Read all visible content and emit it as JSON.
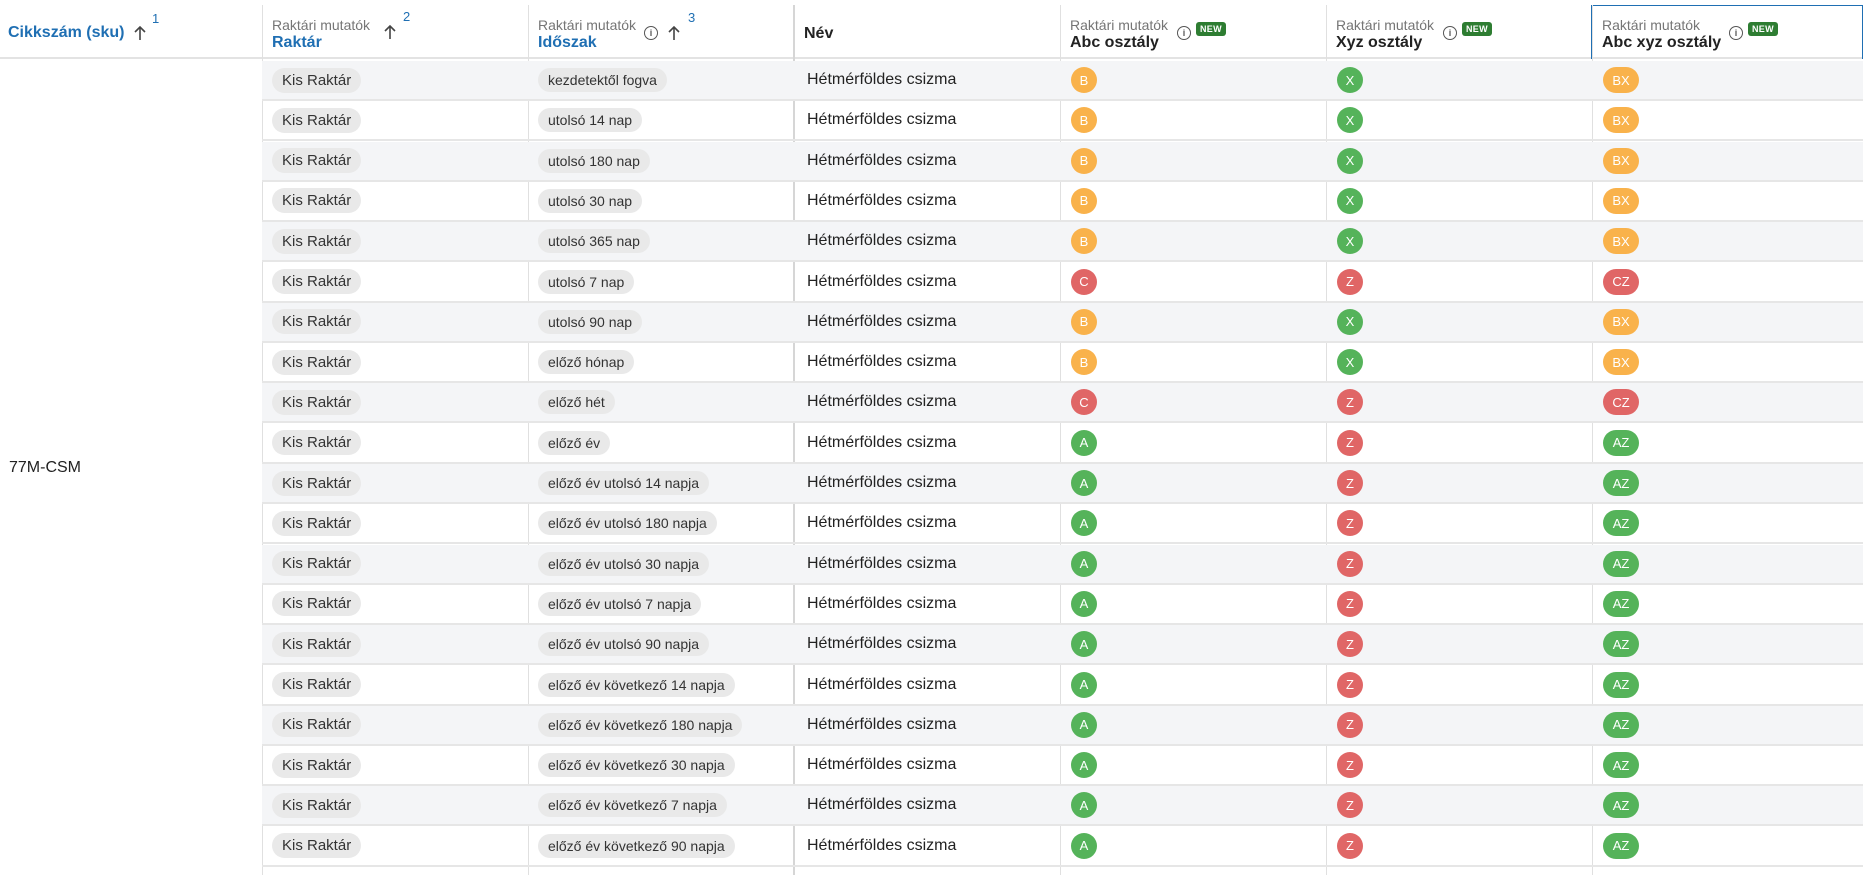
{
  "header": {
    "sku": {
      "title": "Cikkszám (sku)",
      "sort_index": "1"
    },
    "warehouse": {
      "group": "Raktári mutatók",
      "title": "Raktár",
      "sort_index": "2"
    },
    "period": {
      "group": "Raktári mutatók",
      "title": "Időszak",
      "sort_index": "3"
    },
    "name": {
      "title": "Név"
    },
    "abc": {
      "group": "Raktári mutatók",
      "title": "Abc osztály",
      "badge": "NEW"
    },
    "xyz": {
      "group": "Raktári mutatók",
      "title": "Xyz osztály",
      "badge": "NEW"
    },
    "abcxyz": {
      "group": "Raktári mutatók",
      "title": "Abc xyz osztály",
      "badge": "NEW"
    }
  },
  "sku_value": "77M-CSM",
  "colors": {
    "A": "#55b35a",
    "B": "#f9b24b",
    "C": "#e06666",
    "X": "#55b35a",
    "Z": "#e06666",
    "accent": "#1f6fb3"
  },
  "rows": [
    {
      "warehouse": "Kis Raktár",
      "period": "kezdetektől fogva",
      "name": "Hétmérföldes csizma",
      "abc": "B",
      "xyz": "X",
      "abcxyz": "BX"
    },
    {
      "warehouse": "Kis Raktár",
      "period": "utolsó 14 nap",
      "name": "Hétmérföldes csizma",
      "abc": "B",
      "xyz": "X",
      "abcxyz": "BX"
    },
    {
      "warehouse": "Kis Raktár",
      "period": "utolsó 180 nap",
      "name": "Hétmérföldes csizma",
      "abc": "B",
      "xyz": "X",
      "abcxyz": "BX"
    },
    {
      "warehouse": "Kis Raktár",
      "period": "utolsó 30 nap",
      "name": "Hétmérföldes csizma",
      "abc": "B",
      "xyz": "X",
      "abcxyz": "BX"
    },
    {
      "warehouse": "Kis Raktár",
      "period": "utolsó 365 nap",
      "name": "Hétmérföldes csizma",
      "abc": "B",
      "xyz": "X",
      "abcxyz": "BX"
    },
    {
      "warehouse": "Kis Raktár",
      "period": "utolsó 7 nap",
      "name": "Hétmérföldes csizma",
      "abc": "C",
      "xyz": "Z",
      "abcxyz": "CZ"
    },
    {
      "warehouse": "Kis Raktár",
      "period": "utolsó 90 nap",
      "name": "Hétmérföldes csizma",
      "abc": "B",
      "xyz": "X",
      "abcxyz": "BX"
    },
    {
      "warehouse": "Kis Raktár",
      "period": "előző hónap",
      "name": "Hétmérföldes csizma",
      "abc": "B",
      "xyz": "X",
      "abcxyz": "BX"
    },
    {
      "warehouse": "Kis Raktár",
      "period": "előző hét",
      "name": "Hétmérföldes csizma",
      "abc": "C",
      "xyz": "Z",
      "abcxyz": "CZ"
    },
    {
      "warehouse": "Kis Raktár",
      "period": "előző év",
      "name": "Hétmérföldes csizma",
      "abc": "A",
      "xyz": "Z",
      "abcxyz": "AZ"
    },
    {
      "warehouse": "Kis Raktár",
      "period": "előző év utolsó 14 napja",
      "name": "Hétmérföldes csizma",
      "abc": "A",
      "xyz": "Z",
      "abcxyz": "AZ"
    },
    {
      "warehouse": "Kis Raktár",
      "period": "előző év utolsó 180 napja",
      "name": "Hétmérföldes csizma",
      "abc": "A",
      "xyz": "Z",
      "abcxyz": "AZ"
    },
    {
      "warehouse": "Kis Raktár",
      "period": "előző év utolsó 30 napja",
      "name": "Hétmérföldes csizma",
      "abc": "A",
      "xyz": "Z",
      "abcxyz": "AZ"
    },
    {
      "warehouse": "Kis Raktár",
      "period": "előző év utolsó 7 napja",
      "name": "Hétmérföldes csizma",
      "abc": "A",
      "xyz": "Z",
      "abcxyz": "AZ"
    },
    {
      "warehouse": "Kis Raktár",
      "period": "előző év utolsó 90 napja",
      "name": "Hétmérföldes csizma",
      "abc": "A",
      "xyz": "Z",
      "abcxyz": "AZ"
    },
    {
      "warehouse": "Kis Raktár",
      "period": "előző év következő 14 napja",
      "name": "Hétmérföldes csizma",
      "abc": "A",
      "xyz": "Z",
      "abcxyz": "AZ"
    },
    {
      "warehouse": "Kis Raktár",
      "period": "előző év következő 180 napja",
      "name": "Hétmérföldes csizma",
      "abc": "A",
      "xyz": "Z",
      "abcxyz": "AZ"
    },
    {
      "warehouse": "Kis Raktár",
      "period": "előző év következő 30 napja",
      "name": "Hétmérföldes csizma",
      "abc": "A",
      "xyz": "Z",
      "abcxyz": "AZ"
    },
    {
      "warehouse": "Kis Raktár",
      "period": "előző év következő 7 napja",
      "name": "Hétmérföldes csizma",
      "abc": "A",
      "xyz": "Z",
      "abcxyz": "AZ"
    },
    {
      "warehouse": "Kis Raktár",
      "period": "előző év következő 90 napja",
      "name": "Hétmérföldes csizma",
      "abc": "A",
      "xyz": "Z",
      "abcxyz": "AZ"
    }
  ]
}
